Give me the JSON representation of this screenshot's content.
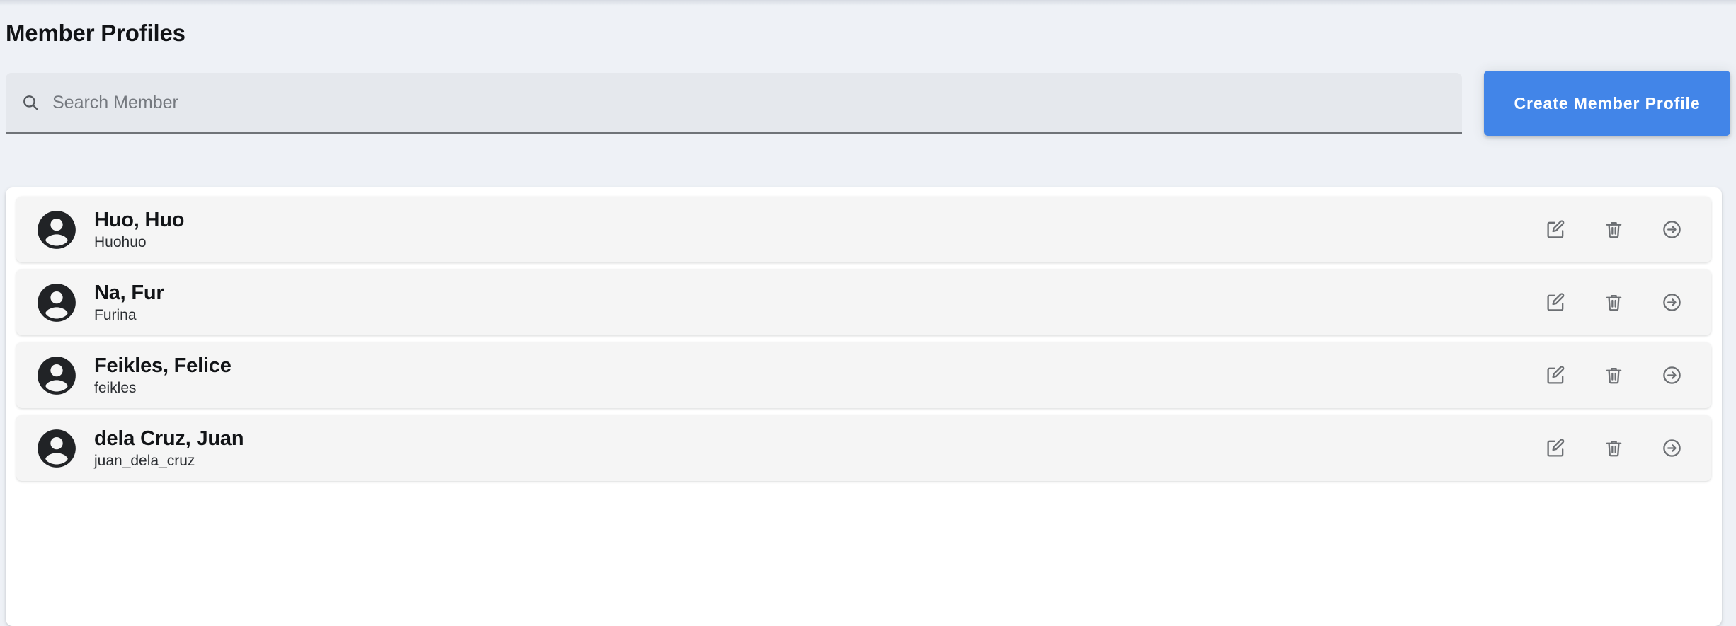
{
  "page": {
    "title": "Member Profiles",
    "accent_color": "#4285e8",
    "background_color": "#eef1f6"
  },
  "toolbar": {
    "search": {
      "placeholder": "Search Member",
      "value": "",
      "icon": "search-icon"
    },
    "create_button": {
      "label": "Create Member Profile"
    }
  },
  "list": {
    "row_actions": [
      {
        "name": "edit-button",
        "icon": "edit-square-pencil-icon",
        "title": "Edit"
      },
      {
        "name": "delete-button",
        "icon": "trash-icon",
        "title": "Delete"
      },
      {
        "name": "open-button",
        "icon": "arrow-right-circle-icon",
        "title": "Open"
      }
    ],
    "members": [
      {
        "name": "Huo, Huo",
        "username": "Huohuo",
        "avatar": "person-avatar-icon"
      },
      {
        "name": "Na, Fur",
        "username": "Furina",
        "avatar": "person-avatar-icon"
      },
      {
        "name": "Feikles, Felice",
        "username": "feikles",
        "avatar": "person-avatar-icon"
      },
      {
        "name": "dela Cruz, Juan",
        "username": "juan_dela_cruz",
        "avatar": "person-avatar-icon"
      }
    ]
  }
}
